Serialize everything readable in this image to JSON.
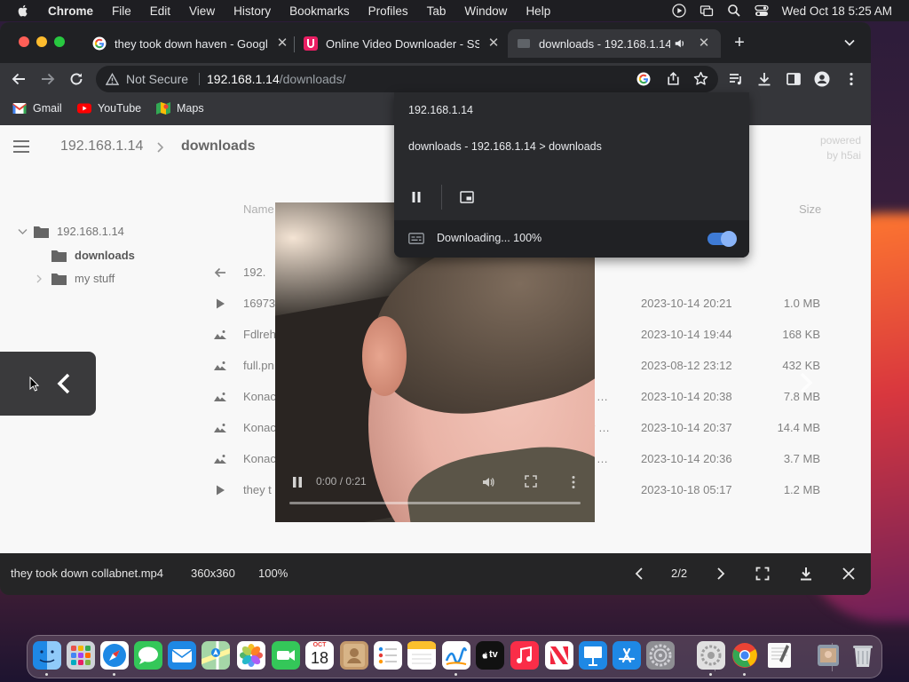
{
  "menubar": {
    "app": "Chrome",
    "items": [
      "File",
      "Edit",
      "View",
      "History",
      "Bookmarks",
      "Profiles",
      "Tab",
      "Window",
      "Help"
    ],
    "clock": "Wed Oct 18  5:25 AM"
  },
  "tabs": [
    {
      "title": "they took down haven - Google",
      "favicon": "google-icon"
    },
    {
      "title": "Online Video Downloader - SS",
      "favicon": "ss-downloader-icon"
    },
    {
      "title": "downloads - 192.168.1.14",
      "favicon": "globe-icon",
      "active": true
    }
  ],
  "omnibox": {
    "security": "Not Secure",
    "host": "192.168.1.14",
    "path": "/downloads/"
  },
  "bookmarks": [
    "Gmail",
    "YouTube",
    "Maps"
  ],
  "page": {
    "breadcrumb": [
      "192.168.1.14",
      "downloads"
    ],
    "powered_by": "powered by h5ai",
    "tree": {
      "root": "192.168.1.14",
      "children": [
        "downloads",
        "my stuff"
      ]
    },
    "columns": {
      "name": "Name",
      "size": "Size"
    },
    "rows": [
      {
        "name": "192.",
        "date": "",
        "size": "",
        "icon": "back-arrow-icon",
        "ellipsis": ""
      },
      {
        "name": "16973",
        "date": "2023-10-14 20:21",
        "size": "1.0 MB",
        "icon": "play-icon",
        "ellipsis": ""
      },
      {
        "name": "Fdlreh",
        "date": "2023-10-14 19:44",
        "size": "168 KB",
        "icon": "image-icon",
        "ellipsis": ""
      },
      {
        "name": "full.pn",
        "date": "2023-08-12 23:12",
        "size": "432 KB",
        "icon": "image-icon",
        "ellipsis": ""
      },
      {
        "name": "Konac",
        "date": "2023-10-14 20:38",
        "size": "7.8 MB",
        "icon": "image-icon",
        "ellipsis": "…"
      },
      {
        "name": "Konac",
        "date": "2023-10-14 20:37",
        "size": "14.4 MB",
        "icon": "image-icon",
        "ellipsis": "r …"
      },
      {
        "name": "Konac",
        "date": "2023-10-14 20:36",
        "size": "3.7 MB",
        "icon": "image-icon",
        "ellipsis": "…"
      },
      {
        "name": "they t",
        "date": "2023-10-18 05:17",
        "size": "1.2 MB",
        "icon": "play-icon",
        "ellipsis": ""
      }
    ]
  },
  "video": {
    "time": "0:00 / 0:21"
  },
  "media_popup": {
    "site": "192.168.1.14",
    "title": "downloads - 192.168.1.14 > downloads",
    "status": "Downloading... 100%"
  },
  "lightbox": {
    "filename": "they took down collabnet.mp4",
    "dimensions": "360x360",
    "zoom": "100%",
    "counter": "2/2"
  },
  "dock": {
    "items": [
      "Finder",
      "Launchpad",
      "Safari",
      "Messages",
      "Mail",
      "Maps",
      "Photos",
      "FaceTime",
      "Calendar",
      "Contacts",
      "Reminders",
      "Notes",
      "Freeform",
      "TV",
      "Music",
      "News",
      "Keynote",
      "App Store",
      "System Settings",
      "Disk Utility",
      "Chrome",
      "TextEdit",
      "Preview",
      "Trash"
    ],
    "calendar_month": "OCT",
    "calendar_day": "18",
    "tv_label": "tv"
  },
  "colors": {
    "accent": "#8ab4f8",
    "toggle": "#3e7bd6"
  }
}
